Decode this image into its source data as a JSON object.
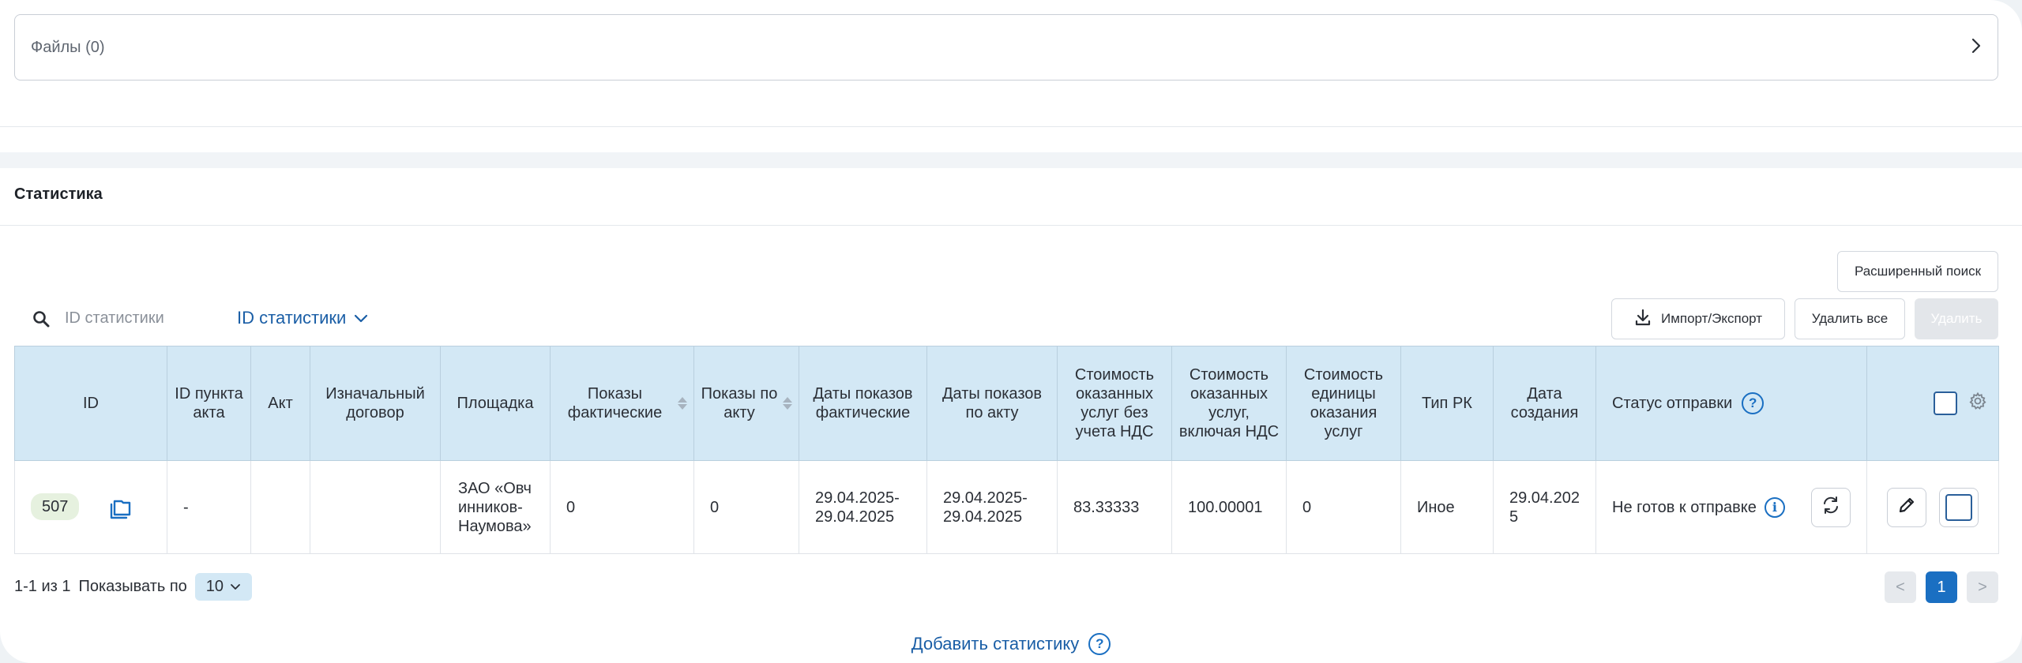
{
  "files": {
    "label": "Файлы (0)",
    "chevron": ">"
  },
  "statistics": {
    "title": "Статистика",
    "advanced_search_label": "Расширенный поиск",
    "import_export_label": "Импорт/Экспорт",
    "delete_all_label": "Удалить все",
    "delete_label": "Удалить",
    "search": {
      "placeholder": "ID статистики",
      "field_label": "ID статистики"
    },
    "columns": [
      "ID",
      "ID пункта акта",
      "Акт",
      "Изначальный договор",
      "Площадка",
      "Показы фактические",
      "Показы по акту",
      "Даты показов фактические",
      "Даты показов по акту",
      "Стоимость оказанных услуг без учета НДС",
      "Стоимость оказанных услуг, включая НДС",
      "Стоимость единицы оказания услуг",
      "Тип РК",
      "Дата создания",
      "Статус отправки"
    ],
    "rows": [
      {
        "id": "507",
        "act_item_id": "-",
        "act": "",
        "original_contract": "",
        "platform": "ЗАО «Овчинников-Наумова»",
        "impressions_actual": "0",
        "impressions_act": "0",
        "dates_actual": "29.04.2025-29.04.2025",
        "dates_act": "29.04.2025-29.04.2025",
        "cost_no_vat": "83.33333",
        "cost_with_vat": "100.00001",
        "unit_cost": "0",
        "campaign_type": "Иное",
        "created_date": "29.04.2025",
        "status": "Не готов к отправке"
      }
    ],
    "pagination": {
      "range": "1-1 из 1",
      "per_page_label": "Показывать по",
      "per_page_value": "10",
      "current_page": "1",
      "prev": "<",
      "next": ">"
    },
    "add_link_label": "Добавить статистику",
    "help_glyph": "?",
    "info_glyph": "i"
  },
  "colors": {
    "header_bg": "#d3e8f5",
    "accent": "#1a6fc2",
    "badge_bg": "#e6f1df"
  },
  "icons": [
    "search-icon",
    "chevron-down-icon",
    "download-icon",
    "help-icon",
    "gear-icon",
    "copy-icon",
    "info-icon",
    "refresh-icon",
    "pencil-icon",
    "chevron-right-icon"
  ]
}
